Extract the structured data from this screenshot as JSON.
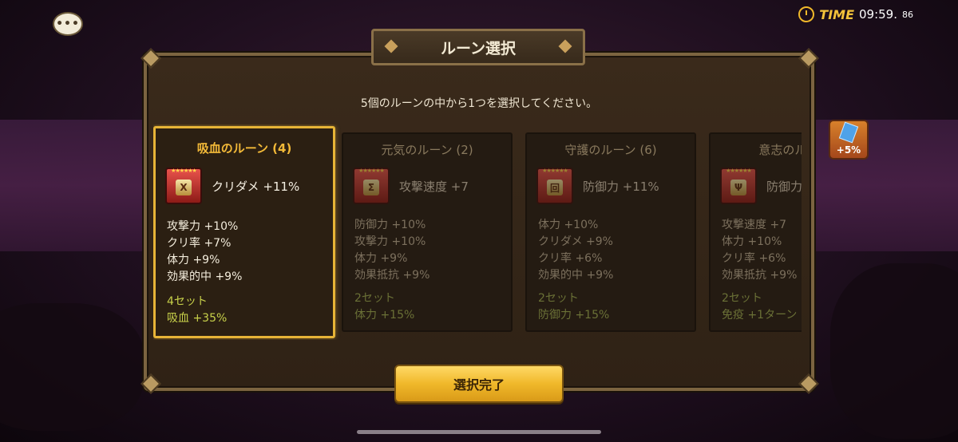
{
  "hud": {
    "chat_icon_text": "•••",
    "time_label": "TIME",
    "time_value": "09:59.",
    "time_fraction": "86"
  },
  "side_tab": {
    "bonus": "+5%"
  },
  "dialog": {
    "title": "ルーン選択",
    "instruction": "5個のルーンの中から1つを選択してください。",
    "confirm_label": "選択完了"
  },
  "runes": [
    {
      "name": "吸血のルーン (4)",
      "stars": "★★★★★★",
      "glyph": "X",
      "main_stat": "クリダメ +11%",
      "subs": [
        "攻撃力 +10%",
        "クリ率 +7%",
        "体力 +9%",
        "効果的中 +9%"
      ],
      "set_count": "4セット",
      "set_bonus": "吸血 +35%",
      "selected": true
    },
    {
      "name": "元気のルーン (2)",
      "stars": "★★★★★★",
      "glyph": "Σ",
      "main_stat": "攻撃速度 +7",
      "subs": [
        "防御力 +10%",
        "攻撃力 +10%",
        "体力 +9%",
        "効果抵抗 +9%"
      ],
      "set_count": "2セット",
      "set_bonus": "体力 +15%",
      "selected": false
    },
    {
      "name": "守護のルーン (6)",
      "stars": "★★★★★★",
      "glyph": "回",
      "main_stat": "防御力 +11%",
      "subs": [
        "体力 +10%",
        "クリダメ +9%",
        "クリ率 +6%",
        "効果的中 +9%"
      ],
      "set_count": "2セット",
      "set_bonus": "防御力 +15%",
      "selected": false
    },
    {
      "name": "意志のルーン",
      "stars": "★★★★★★",
      "glyph": "Ψ",
      "main_stat": "防御力",
      "subs": [
        "攻撃速度 +7",
        "体力 +10%",
        "クリ率 +6%",
        "効果抵抗 +9%"
      ],
      "set_count": "2セット",
      "set_bonus": "免疫 +1ターン",
      "selected": false
    }
  ]
}
